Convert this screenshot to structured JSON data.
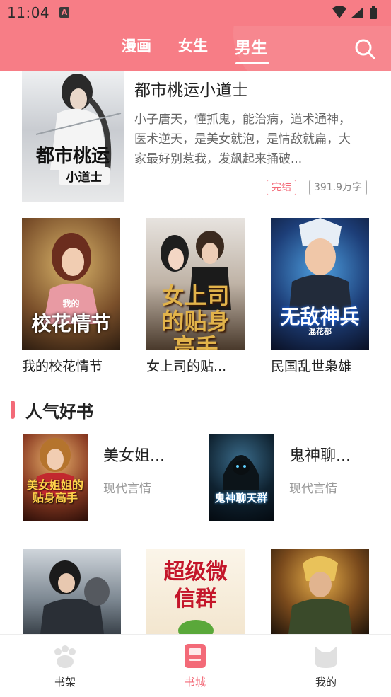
{
  "status_bar": {
    "time": "11:04",
    "icon_letter": "A"
  },
  "top_tabs": [
    {
      "label": "漫画",
      "active": false
    },
    {
      "label": "女生",
      "active": false
    },
    {
      "label": "男生",
      "active": true
    }
  ],
  "featured": {
    "cover_text": "都市桃运",
    "cover_subtext": "小道士",
    "title": "都市桃运小道士",
    "desc_lines": [
      "小子唐天，懂抓鬼，能治病，道术通神，",
      "医术逆天，是美女就泡，是情敌就扁，大",
      "家最好别惹我，发飙起来捅破..."
    ],
    "status_badge": "完结",
    "word_count": "391.9万字"
  },
  "grid_row_1": [
    {
      "title": "我的校花情节",
      "cover_text": "校花情节",
      "cover_small": "我的"
    },
    {
      "title": "女上司的贴...",
      "cover_text": "女上司的贴身高手"
    },
    {
      "title": "民国乱世枭雄",
      "cover_text": "无敌神兵",
      "cover_small": "混花都"
    }
  ],
  "section": {
    "title": "人气好书"
  },
  "popular": [
    {
      "title": "美女姐...",
      "genre": "现代言情",
      "cover_text": "美女姐姐的贴身高手"
    },
    {
      "title": "鬼神聊...",
      "genre": "现代言情",
      "cover_text": "鬼神聊天群"
    }
  ],
  "grid_row_2": [
    {
      "cover_text": ""
    },
    {
      "cover_text": "超级微信群"
    },
    {
      "cover_text": ""
    }
  ],
  "bottom_nav": [
    {
      "label": "书架",
      "active": false
    },
    {
      "label": "书城",
      "active": true
    },
    {
      "label": "我的",
      "active": false
    }
  ],
  "colors": {
    "accent": "#f77d86",
    "active_label": "#f36a78",
    "inactive_label": "#333333"
  }
}
